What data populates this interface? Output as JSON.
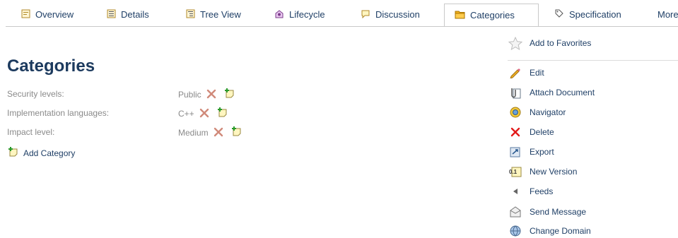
{
  "tabs": [
    {
      "label": "Overview",
      "icon": "overview-icon"
    },
    {
      "label": "Details",
      "icon": "details-icon"
    },
    {
      "label": "Tree View",
      "icon": "tree-view-icon"
    },
    {
      "label": "Lifecycle",
      "icon": "lifecycle-icon"
    },
    {
      "label": "Discussion",
      "icon": "discussion-icon"
    },
    {
      "label": "Categories",
      "icon": "folder-icon",
      "active": true
    },
    {
      "label": "Specification",
      "icon": "tag-icon"
    },
    {
      "label": "More",
      "icon": ""
    }
  ],
  "page_title": "Categories",
  "categories": [
    {
      "label": "Security levels:",
      "value": "Public"
    },
    {
      "label": "Implementation languages:",
      "value": "C++"
    },
    {
      "label": "Impact level:",
      "value": "Medium"
    }
  ],
  "add_category_label": "Add Category",
  "menu": {
    "favorites_label": "Add to Favorites",
    "items": [
      {
        "label": "Edit",
        "icon": "pencil-icon"
      },
      {
        "label": "Attach Document",
        "icon": "paperclip-icon"
      },
      {
        "label": "Navigator",
        "icon": "navigator-icon"
      },
      {
        "label": "Delete",
        "icon": "delete-icon"
      },
      {
        "label": "Export",
        "icon": "export-icon"
      },
      {
        "label": "New Version",
        "icon": "new-version-icon"
      },
      {
        "label": "Feeds",
        "icon": "feeds-icon"
      },
      {
        "label": "Send Message",
        "icon": "envelope-icon"
      },
      {
        "label": "Change Domain",
        "icon": "globe-icon"
      }
    ]
  },
  "colors": {
    "link": "#1f3f66",
    "heading": "#1c3a5e",
    "label": "#8a8a8a",
    "delete": "#e21a1a",
    "folder": "#f3b11e"
  }
}
